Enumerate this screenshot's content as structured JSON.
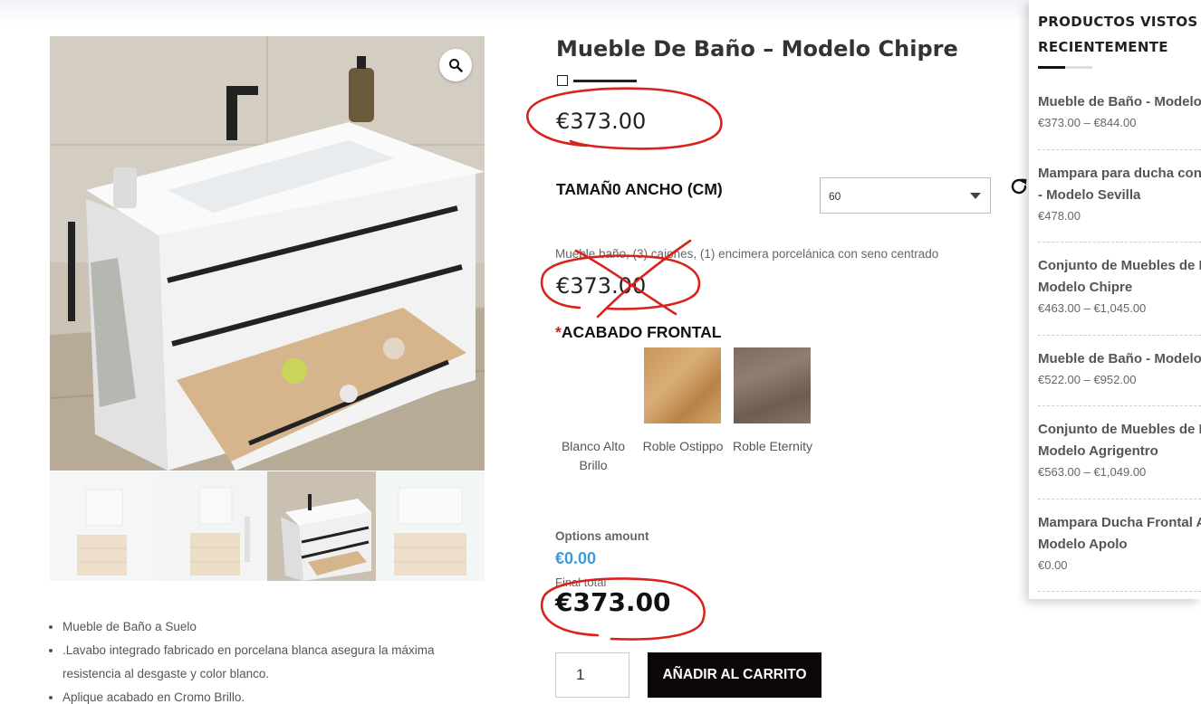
{
  "product": {
    "title": "Mueble De Baño – Modelo Chipre",
    "price": "€373.00",
    "size_label": "TAMAÑ0 ANCHO (CM)",
    "size_value": "60",
    "variation_description": "Mueble baño, (3) cajones, (1) encimera porcelánica con seno centrado",
    "variation_price": "€373.00",
    "acabado_required_mark": "*",
    "acabado_label": "ACABADO FRONTAL",
    "finishes": [
      {
        "name": "Blanco Alto Brillo"
      },
      {
        "name": "Roble Ostippo"
      },
      {
        "name": "Roble Eternity"
      }
    ],
    "options_amount_label": "Options amount",
    "options_amount": "€0.00",
    "final_total_label": "Final total",
    "final_total": "€373.00",
    "quantity": "1",
    "add_to_cart": "AÑADIR AL CARRITO"
  },
  "features": [
    "Mueble de Baño  a Suelo",
    ".Lavabo integrado fabricado en porcelana blanca asegura la máxima resistencia al desgaste y color blanco.",
    "Aplique acabado en Cromo Brillo."
  ],
  "recent": {
    "title": "PRODUCTOS VISTOS RECIENTEMENTE",
    "items": [
      {
        "name_line1": "Mueble de Baño - Modelo",
        "name_line2": "",
        "price": "€373.00 – €844.00"
      },
      {
        "name_line1": "Mampara para ducha con",
        "name_line2": "- Modelo Sevilla",
        "price": "€478.00"
      },
      {
        "name_line1": "Conjunto de Muebles de B",
        "name_line2": "Modelo Chipre",
        "price": "€463.00 – €1,045.00"
      },
      {
        "name_line1": "Mueble de Baño - Modelo",
        "name_line2": "",
        "price": "€522.00 – €952.00"
      },
      {
        "name_line1": "Conjunto de Muebles de B",
        "name_line2": "Modelo Agrigentro",
        "price": "€563.00 – €1,049.00"
      },
      {
        "name_line1": "Mampara Ducha Frontal A",
        "name_line2": "Modelo Apolo",
        "price": "€0.00"
      }
    ]
  },
  "icons": {
    "zoom": "magnifier-icon",
    "reset": "refresh-icon",
    "select_arrow": "caret-down-icon"
  },
  "colors": {
    "accent_blue": "#3b9ad9",
    "required_red": "#d21f1f",
    "button_bg": "#0d0606",
    "annotation_red": "#d9221c"
  }
}
